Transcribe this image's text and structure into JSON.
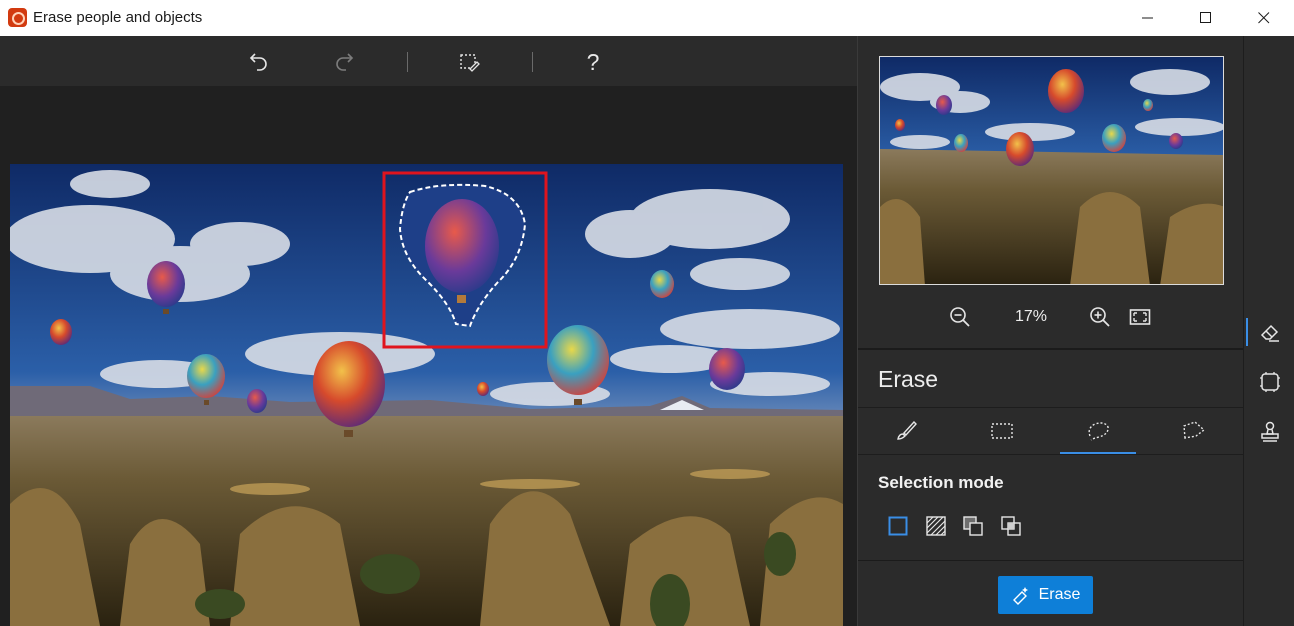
{
  "window": {
    "title": "Erase people and objects"
  },
  "toolbar": {
    "buttons": [
      "undo-icon",
      "redo-icon",
      "selection-edit-icon",
      "help-icon"
    ],
    "help_label": "?"
  },
  "preview": {
    "zoom_level": "17%"
  },
  "panel": {
    "section_title": "Erase",
    "tabs": [
      "brush",
      "rectangle-select",
      "lasso-select",
      "polygon-select"
    ],
    "active_tab": "lasso-select",
    "selection_mode_label": "Selection mode",
    "selection_modes": [
      "new",
      "add",
      "subtract",
      "intersect"
    ],
    "active_mode": "new",
    "erase_button_label": "Erase"
  },
  "side_tools": [
    "eraser-icon",
    "crop-select-icon",
    "stamp-icon"
  ],
  "active_side_tool": "eraser-icon",
  "colors": {
    "accent": "#0e7fd8",
    "highlight": "#e0141e",
    "panel_bg": "#2b2b2b"
  }
}
